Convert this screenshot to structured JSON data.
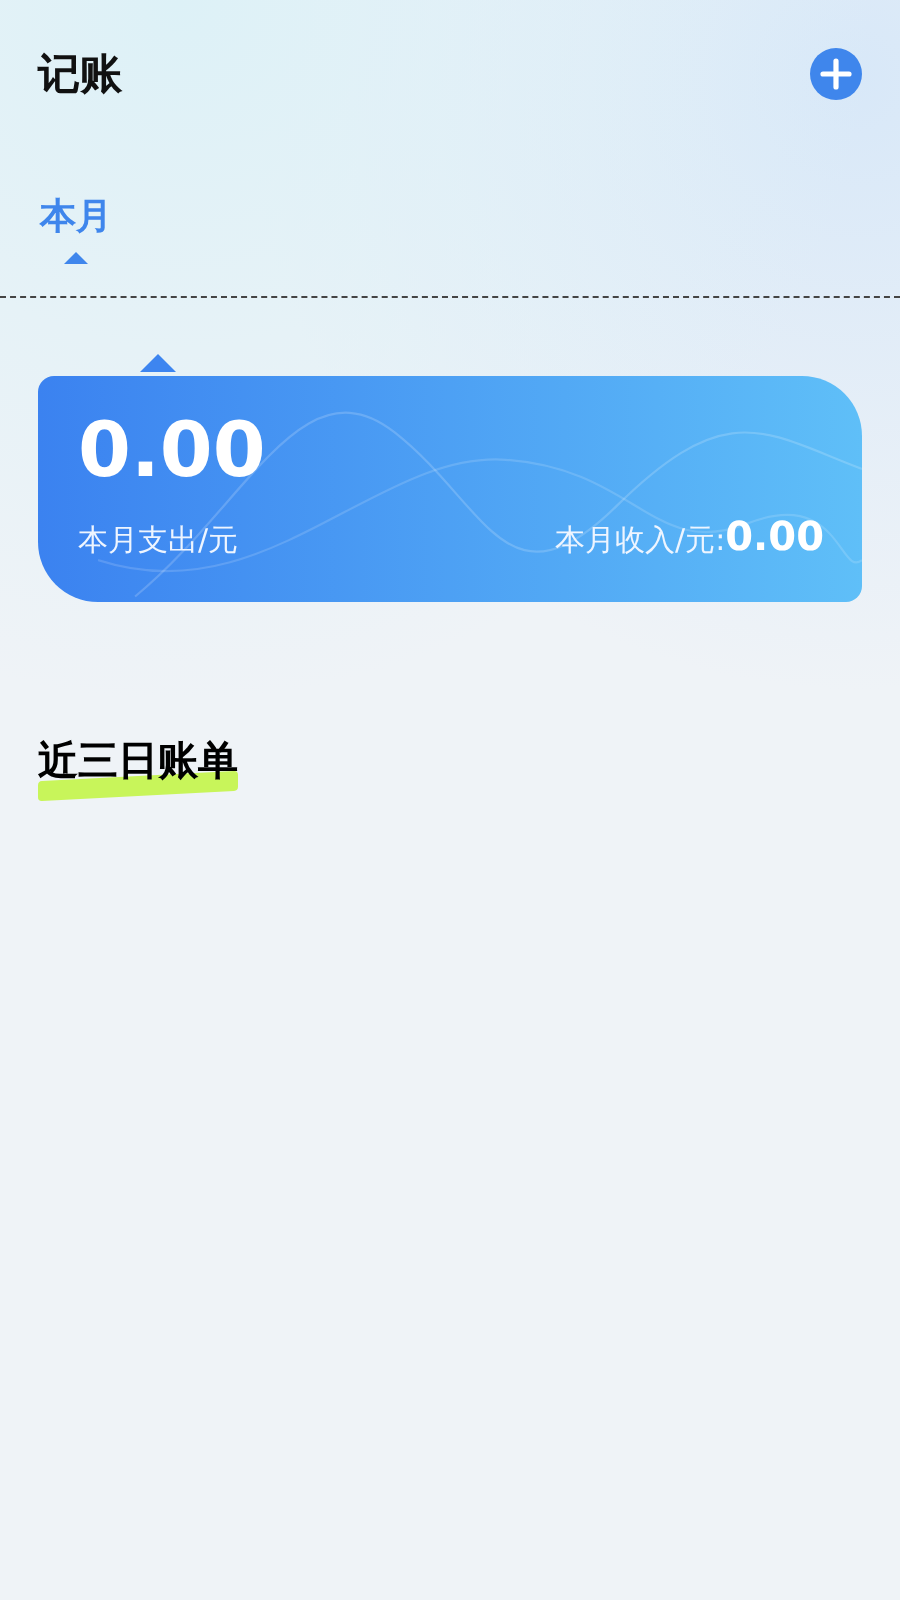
{
  "header": {
    "title": "记账"
  },
  "tabs": [
    {
      "label": "本月",
      "selected": true
    }
  ],
  "summary": {
    "expense": "0.00",
    "expense_label": "本月支出/元",
    "income_label": "本月收入/元:",
    "income": "0.00"
  },
  "section": {
    "title": "近三日账单"
  }
}
